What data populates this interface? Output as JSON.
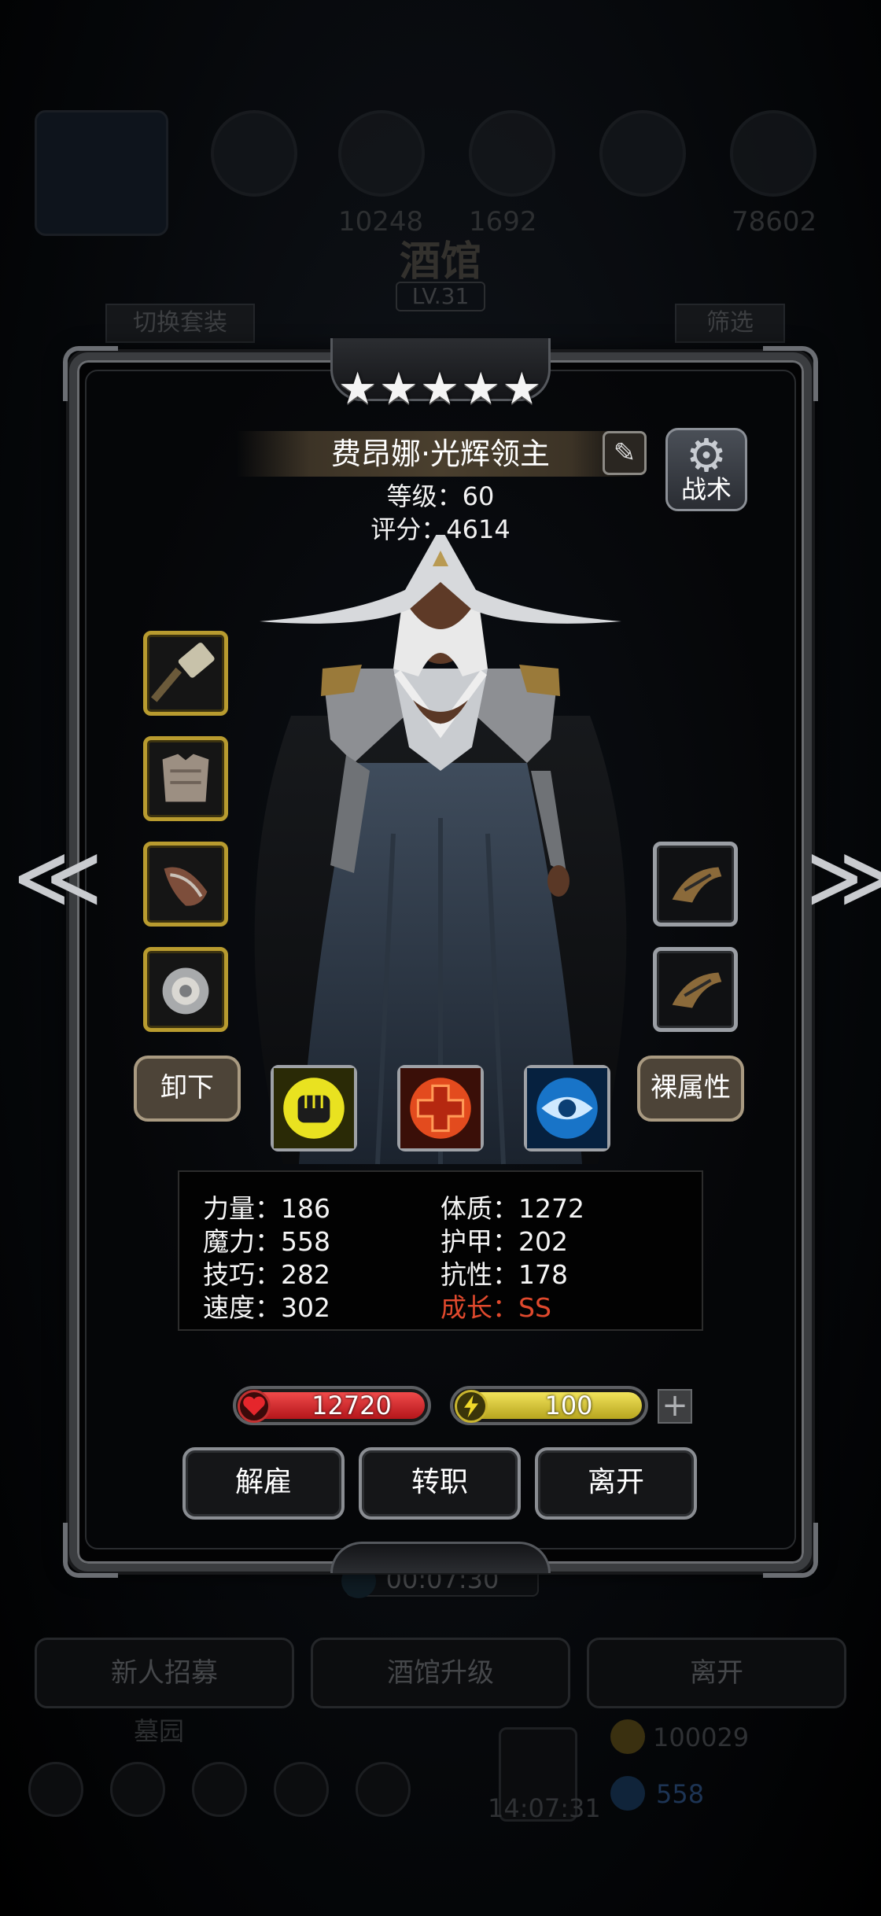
{
  "background": {
    "title": "酒馆",
    "level_badge": "LV.31",
    "switch_set_button": "切换套装",
    "filter_button": "筛选",
    "top_numbers": [
      "10248",
      "1692",
      "78602"
    ],
    "timer": "00:07:30",
    "bottom_buttons": [
      "新人招募",
      "酒馆升级",
      "离开"
    ],
    "graveyard_label": "墓园",
    "gold": "100029",
    "gems": "558",
    "clock": "14:07:31"
  },
  "hero": {
    "stars": "★★★★★",
    "name": "费昂娜·光辉领主",
    "level_text": "等级：60",
    "score_text": "评分：4614"
  },
  "buttons": {
    "tactics": "战术",
    "unequip": "卸下",
    "base_attributes": "裸属性",
    "dismiss": "解雇",
    "change_class": "转职",
    "leave": "离开",
    "prev_arrow": "≪",
    "next_arrow": "≫",
    "add_energy": "+"
  },
  "equipment_left": [
    "hammer-icon",
    "chest-armor-icon",
    "bracer-icon",
    "ring-icon"
  ],
  "equipment_right": [
    "gauntlet-icon",
    "gauntlet-icon"
  ],
  "skills": [
    "fist-skill-icon",
    "heal-cross-skill-icon",
    "eye-skill-icon"
  ],
  "stats": {
    "strength": "力量：186",
    "magic": "魔力：558",
    "skill": "技巧：282",
    "speed": "速度：302",
    "constitution": "体质：1272",
    "armor": "护甲：202",
    "resistance": "抗性：178",
    "growth": "成长：SS"
  },
  "bars": {
    "hp": "12720",
    "energy": "100"
  },
  "colors": {
    "hp_bar": "#d8262a",
    "energy_bar": "#d6c63a",
    "growth_text": "#e0492d",
    "equip_border_gold": "#b89b2f"
  }
}
